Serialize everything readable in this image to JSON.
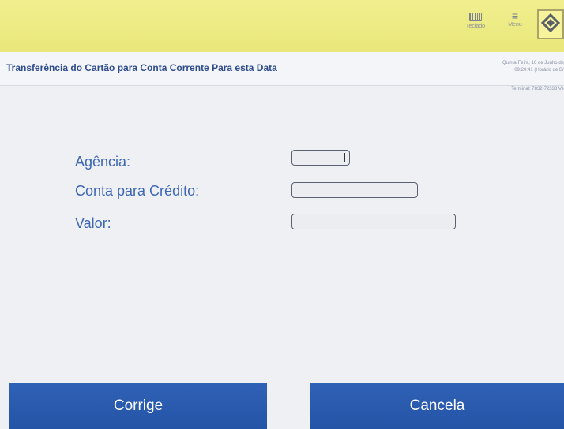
{
  "toolbar": {
    "teclado_label": "Teclado",
    "menu_label": "Menu"
  },
  "header": {
    "title": "Transferência do Cartão para Conta Corrente Para esta Data",
    "date_line1": "Quinta-Feira, 16 de Junho de",
    "date_line2": "09:20:41 (Horário de Br",
    "terminal": "Terminal: 7832-72338 Ve"
  },
  "form": {
    "agencia_label": "Agência:",
    "agencia_value": "",
    "conta_label": "Conta para Crédito:",
    "conta_value": "",
    "valor_label": "Valor:",
    "valor_value": ""
  },
  "buttons": {
    "corrige": "Corrige",
    "cancela": "Cancela"
  },
  "colors": {
    "topbar": "#ebe97f",
    "title": "#2e4c8c",
    "label": "#3e67b3",
    "button": "#2a5ab0"
  }
}
